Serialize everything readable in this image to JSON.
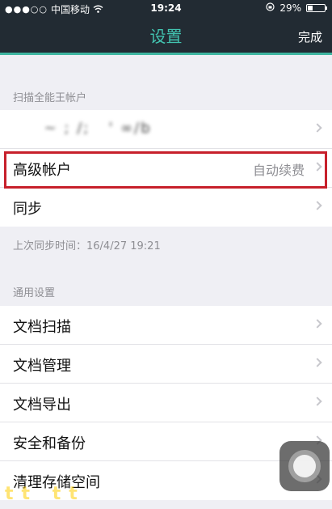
{
  "status_bar": {
    "carrier": "中国移动",
    "time": "19:24",
    "battery_percent": "29%",
    "battery_level": 0.29,
    "icons": [
      "signal-dots-icon",
      "wifi-icon",
      "rotation-lock-icon",
      "battery-icon"
    ]
  },
  "nav": {
    "title": "设置",
    "done": "完成"
  },
  "account_section": {
    "header": "扫描全能王帐户",
    "account_name": "     ~ ; /;   ' ∞/b",
    "premium_label": "高级帐户",
    "premium_value": "自动续费",
    "sync_label": "同步"
  },
  "last_sync": "上次同步时间：16/4/27 19:21",
  "general_section": {
    "header": "通用设置",
    "items": [
      "文档扫描",
      "文档管理",
      "文档导出",
      "安全和备份",
      "清理存储空间"
    ]
  },
  "watermark": "tt tt",
  "colors": {
    "nav_bg": "#222b33",
    "accent": "#42c3b0",
    "highlight": "#c7202b",
    "page_bg": "#efeff4"
  }
}
